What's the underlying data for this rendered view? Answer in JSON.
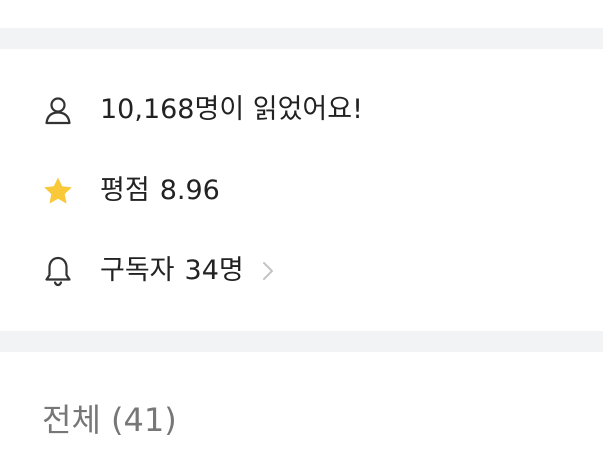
{
  "stats": {
    "readers": {
      "icon": "person-icon",
      "text": "10,168명이 읽었어요!"
    },
    "rating": {
      "icon": "star-icon",
      "label": "평점",
      "value": "8.96"
    },
    "subscribers": {
      "icon": "bell-icon",
      "label": "구독자",
      "value": "34명"
    }
  },
  "section": {
    "title": "전체 (41)"
  },
  "colors": {
    "star": "#F9C93A",
    "divider": "#F2F3F5",
    "text": "#222222",
    "muted_text": "#777777",
    "chevron": "#C4C4C4"
  }
}
